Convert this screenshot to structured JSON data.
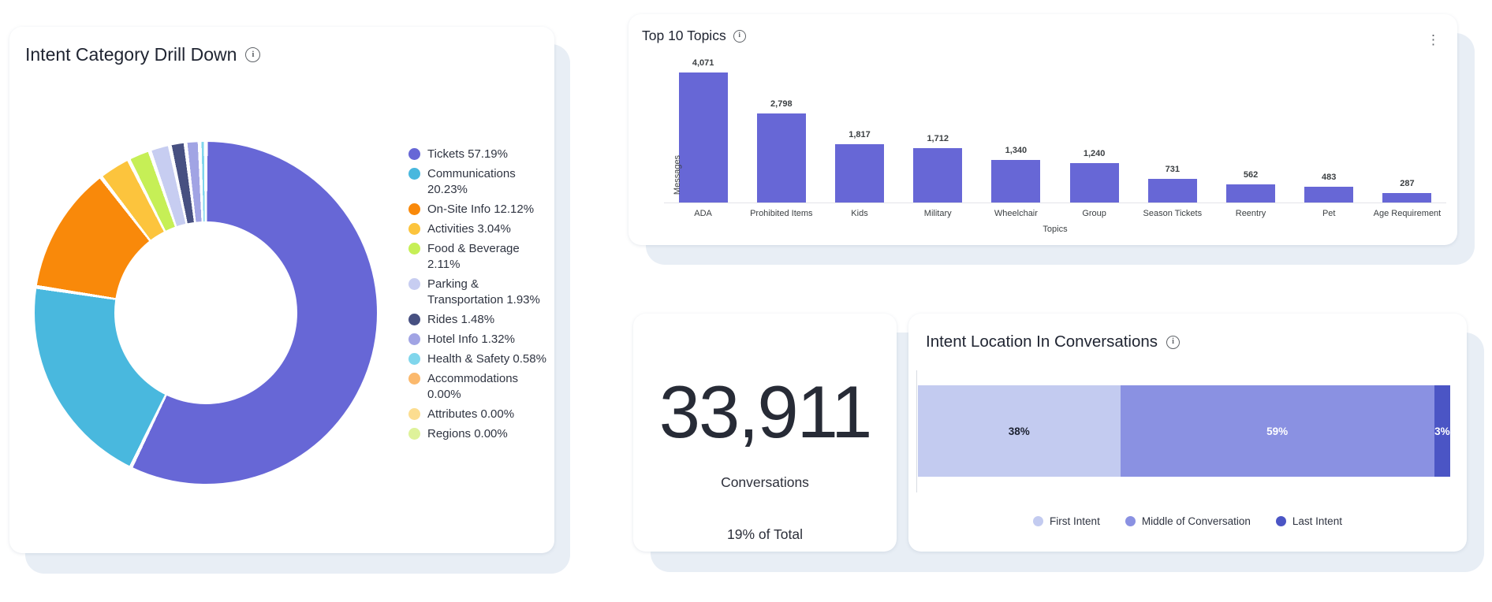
{
  "colors": {
    "accent_indigo": "#6767d6",
    "backdrop": "#e8eef5",
    "title_text": "#202532"
  },
  "icons": {
    "info": "i",
    "kebab": "⋮"
  },
  "cards": {
    "intent_category": {
      "title": "Intent Category Drill Down"
    },
    "top_topics": {
      "title": "Top 10 Topics"
    },
    "conversations_stat": {
      "value": "33,911",
      "label": "Conversations",
      "subtext": "19% of Total"
    },
    "intent_location": {
      "title": "Intent Location In Conversations"
    }
  },
  "chart_data": [
    {
      "type": "pie",
      "subtype": "donut",
      "title": "Intent Category Drill Down",
      "inner_radius_ratio": 0.54,
      "start_angle_deg": 0,
      "direction": "clockwise",
      "legend_position": "right",
      "slices": [
        {
          "label": "Tickets",
          "value": 57.19,
          "color": "#6767d6"
        },
        {
          "label": "Communications",
          "value": 20.23,
          "color": "#49b8de"
        },
        {
          "label": "On-Site Info",
          "value": 12.12,
          "color": "#f9890a"
        },
        {
          "label": "Activities",
          "value": 3.04,
          "color": "#fcc43d"
        },
        {
          "label": "Food & Beverage",
          "value": 2.11,
          "color": "#c6ef56"
        },
        {
          "label": "Parking & Transportation",
          "value": 1.93,
          "color": "#c7cdf1"
        },
        {
          "label": "Rides",
          "value": 1.48,
          "color": "#475081"
        },
        {
          "label": "Hotel Info",
          "value": 1.32,
          "color": "#a1a4e4"
        },
        {
          "label": "Health & Safety",
          "value": 0.58,
          "color": "#80d6ec"
        },
        {
          "label": "Accommodations",
          "value": 0.0,
          "color": "#fbb96d"
        },
        {
          "label": "Attributes",
          "value": 0.0,
          "color": "#fcdd90"
        },
        {
          "label": "Regions",
          "value": 0.0,
          "color": "#def29a"
        }
      ]
    },
    {
      "type": "bar",
      "title": "Top 10 Topics",
      "categories": [
        "ADA",
        "Prohibited Items",
        "Kids",
        "Military",
        "Wheelchair",
        "Group",
        "Season Tickets",
        "Reentry",
        "Pet",
        "Age Requirement"
      ],
      "values": [
        4071,
        2798,
        1817,
        1712,
        1340,
        1240,
        731,
        562,
        483,
        287
      ],
      "xlabel": "Topics",
      "ylabel": "Messages",
      "ylim": [
        0,
        4071
      ],
      "bar_color": "#6767d6",
      "grid": false,
      "value_labels": true
    },
    {
      "type": "bar",
      "subtype": "stacked-horizontal",
      "title": "Intent Location In Conversations",
      "legend_position": "bottom",
      "segments": [
        {
          "label": "First Intent",
          "value": 38,
          "color": "#c3cbf0",
          "text_color": "#1c2130"
        },
        {
          "label": "Middle of Conversation",
          "value": 59,
          "color": "#8a91e2",
          "text_color": "#ffffff"
        },
        {
          "label": "Last Intent",
          "value": 3,
          "color": "#4b55c5",
          "text_color": "#ffffff"
        }
      ]
    }
  ]
}
